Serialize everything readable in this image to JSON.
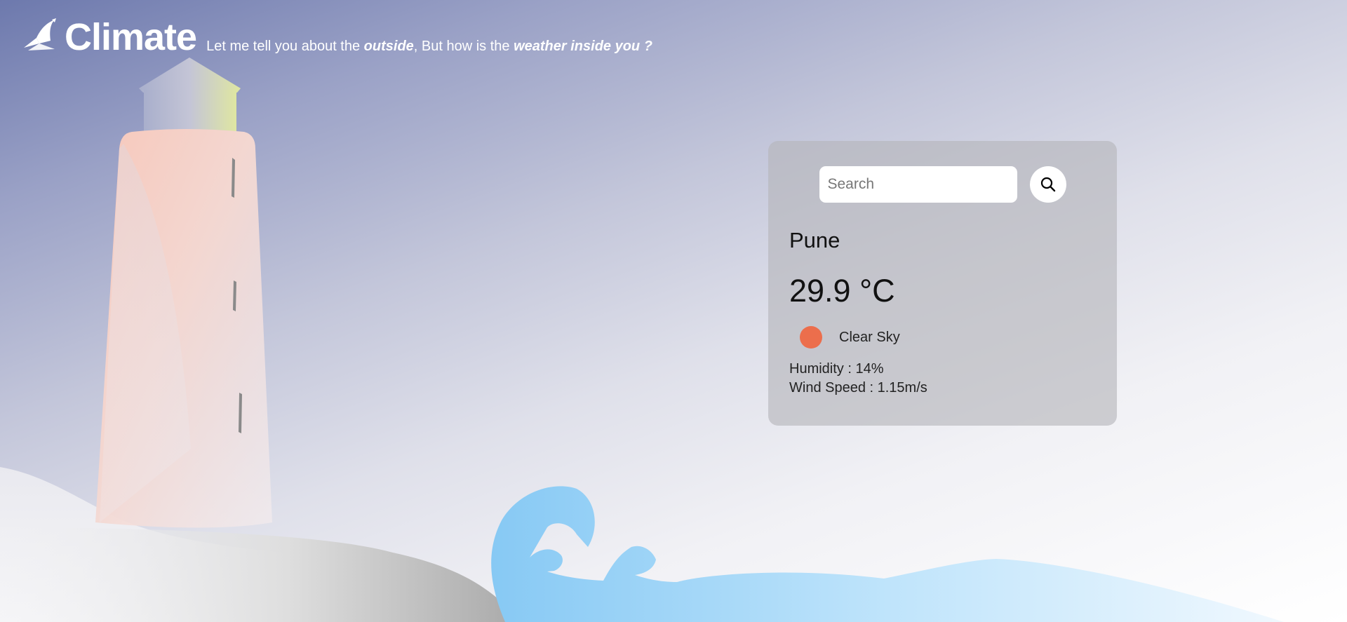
{
  "brand": {
    "name": "Climate",
    "logo_icon": "paper-boat-icon"
  },
  "tagline": {
    "part1": "Let me tell you about the ",
    "emphasis1": "outside",
    "part2": ", But how is the ",
    "emphasis2": "weather inside you ?"
  },
  "search": {
    "placeholder": "Search",
    "value": "",
    "button_icon": "search-icon"
  },
  "weather": {
    "city": "Pune",
    "temperature": "29.9 °C",
    "description": "Clear Sky",
    "icon": "sun-icon",
    "icon_color": "#ec6e4c",
    "humidity": "Humidity : 14%",
    "wind_speed": "Wind Speed : 1.15m/s"
  },
  "colors": {
    "sky_top": "#6d79ad",
    "sky_bottom": "#ffffff",
    "lighthouse": "#f6bfb0",
    "wave": "#8dcdf4",
    "rock": "#b9b9b9"
  }
}
